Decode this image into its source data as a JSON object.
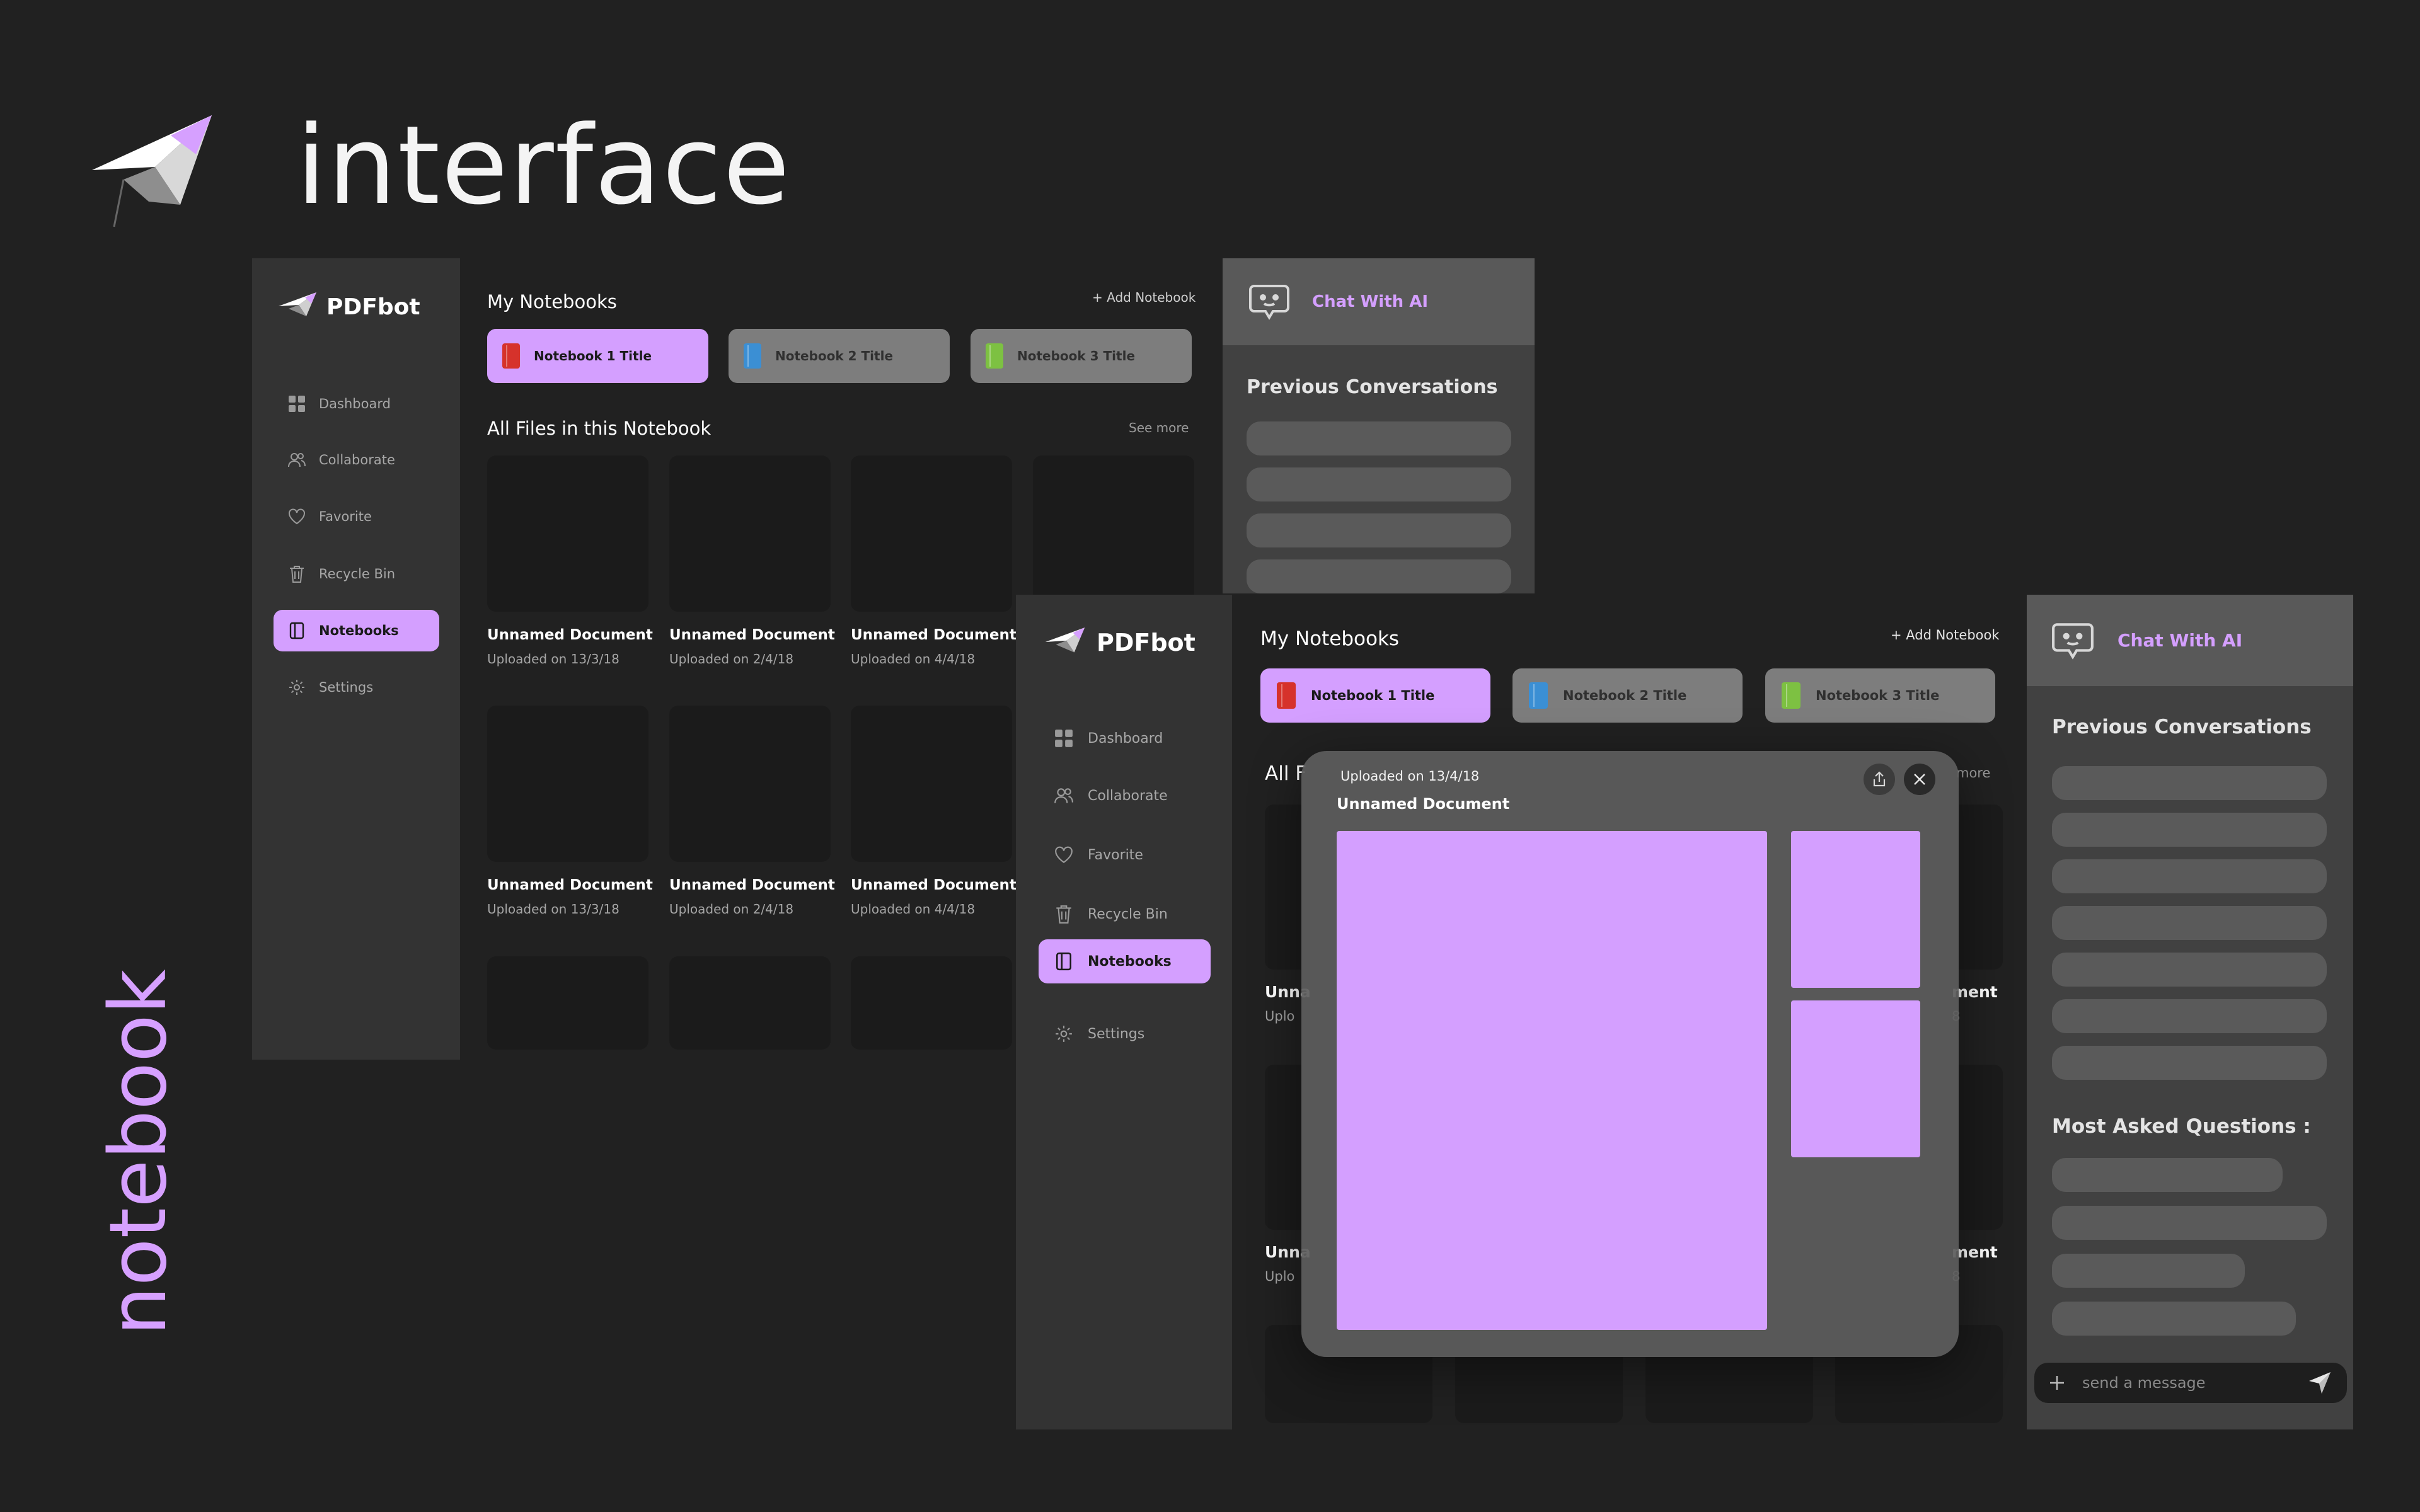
{
  "hero": {
    "title": "interface",
    "side_label": "notebook"
  },
  "brand": {
    "name": "PDFbot"
  },
  "sidebar": {
    "items": [
      {
        "label": "Dashboard",
        "icon": "grid-icon"
      },
      {
        "label": "Collaborate",
        "icon": "users-icon"
      },
      {
        "label": "Favorite",
        "icon": "heart-icon"
      },
      {
        "label": "Recycle Bin",
        "icon": "trash-icon"
      },
      {
        "label": "Notebooks",
        "icon": "notebook-icon",
        "active": true
      },
      {
        "label": "Settings",
        "icon": "gear-icon"
      }
    ]
  },
  "main": {
    "my_notebooks": "My Notebooks",
    "add_notebook": "+ Add Notebook",
    "notebooks": [
      {
        "title": "Notebook 1 Title",
        "color": "#d6322b"
      },
      {
        "title": "Notebook 2 Title",
        "color": "#3b8fd4"
      },
      {
        "title": "Notebook 3 Title",
        "color": "#7dc142"
      }
    ],
    "all_files": "All Files in this Notebook",
    "see_more": "See more",
    "files_row1": [
      {
        "title": "Unnamed Document",
        "date": "Uploaded on 13/3/18"
      },
      {
        "title": "Unnamed Document",
        "date": "Uploaded on 2/4/18"
      },
      {
        "title": "Unnamed Document",
        "date": "Uploaded on 4/4/18"
      }
    ],
    "files_row2": [
      {
        "title": "Unnamed Document",
        "date": "Uploaded on 13/3/18"
      },
      {
        "title": "Unnamed Document",
        "date": "Uploaded on 2/4/18"
      },
      {
        "title": "Unnamed Document",
        "date": "Uploaded on 4/4/18"
      }
    ],
    "behind_modal": {
      "all_prefix": "All F",
      "more": "more",
      "unnamed_prefix": "Unna",
      "upload_prefix": "Uplo",
      "ment": "ment",
      "eight": "8"
    }
  },
  "chat": {
    "title": "Chat With AI",
    "previous": "Previous Conversations",
    "most_asked": "Most Asked Questions :",
    "message_placeholder": "send a message"
  },
  "modal": {
    "date": "Uploaded on 13/4/18",
    "title": "Unnamed Document"
  },
  "colors": {
    "accent": "#d49fff",
    "background": "#212121",
    "sidebar": "#333333"
  }
}
